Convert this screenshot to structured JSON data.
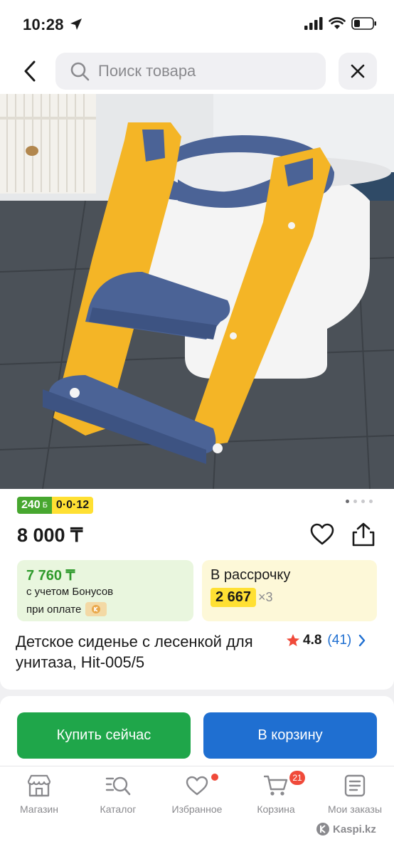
{
  "status_bar": {
    "time": "10:28"
  },
  "search": {
    "placeholder": "Поиск товара"
  },
  "product": {
    "badges": {
      "bonus": "240",
      "bonus_currency": "Б",
      "installment": "0·0·12"
    },
    "gallery": {
      "dot_count": 4,
      "active_index": 0
    },
    "price": "8 000 ₸",
    "bonus_offer": {
      "price": "7 760 ₸",
      "line1": "с учетом Бонусов",
      "line2": "при оплате"
    },
    "installment_offer": {
      "title": "В рассрочку",
      "amount": "2 667",
      "times": "×3"
    },
    "title": "Детское сиденье с лесенкой для унитаза, Hit-005/5",
    "rating": {
      "value": "4.8",
      "reviews": "(41)"
    }
  },
  "actions": {
    "buy_now": "Купить сейчас",
    "add_to_cart": "В корзину"
  },
  "tab_bar": {
    "items": [
      {
        "label": "Магазин",
        "icon": "store-icon"
      },
      {
        "label": "Каталог",
        "icon": "catalog-search-icon"
      },
      {
        "label": "Избранное",
        "icon": "heart-icon"
      },
      {
        "label": "Корзина",
        "icon": "cart-icon"
      },
      {
        "label": "Мои заказы",
        "icon": "orders-icon"
      }
    ],
    "cart_badge": "21"
  },
  "watermark": "Kaspi.kz",
  "colors": {
    "green": "#1fa64a",
    "blue": "#1f6fd1",
    "yellow": "#ffe033",
    "red": "#f04a3a"
  }
}
